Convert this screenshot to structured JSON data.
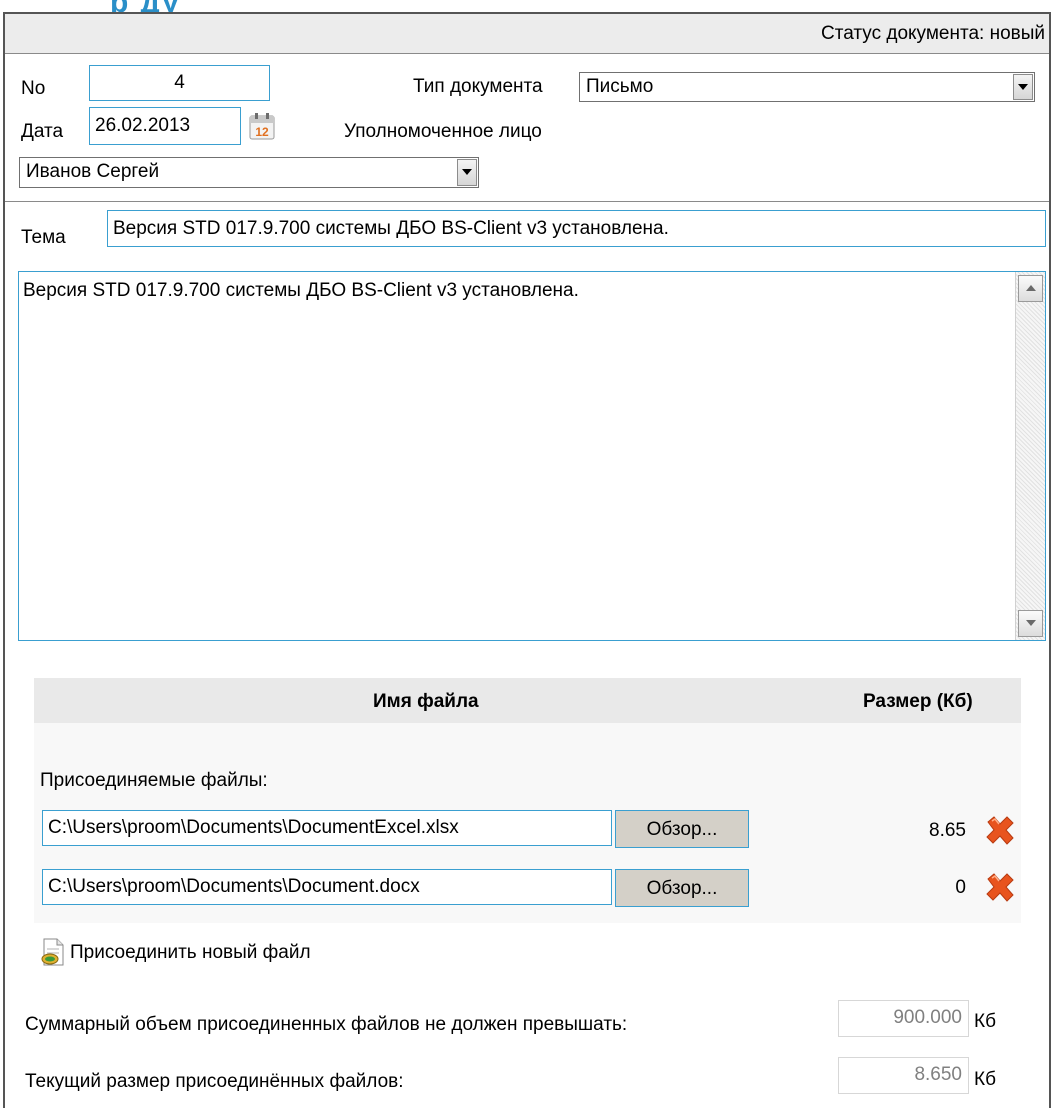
{
  "header": {
    "title_fragment": "р          ду",
    "status_label": "Статус документа: новый"
  },
  "form": {
    "number_label": "No",
    "number_value": "4",
    "doc_type_label": "Тип документа",
    "doc_type_value": "Письмо",
    "date_label": "Дата",
    "date_value": "26.02.2013",
    "calendar_day": "12",
    "authorized_label": "Уполномоченное лицо",
    "authorized_value": "Иванов Сергей",
    "subject_label": "Тема",
    "subject_value": "Версия STD 017.9.700 системы ДБО BS-Client v3 установлена.",
    "body_text": "Версия STD 017.9.700 системы ДБО BS-Client v3 установлена."
  },
  "files": {
    "col_name": "Имя файла",
    "col_size": "Размер (Кб)",
    "attached_label": "Присоединяемые файлы:",
    "rows": [
      {
        "path": "C:\\Users\\proom\\Documents\\DocumentExcel.xlsx",
        "browse": "Обзор...",
        "size": "8.65"
      },
      {
        "path": "C:\\Users\\proom\\Documents\\Document.docx",
        "browse": "Обзор...",
        "size": "0"
      }
    ],
    "attach_new_label": "Присоединить новый файл"
  },
  "limits": {
    "max_label": "Суммарный объем присоединенных файлов не должен превышать:",
    "max_value": "900.000",
    "max_unit": "Кб",
    "current_label": "Текущий размер присоединённых файлов:",
    "current_value": "8.650",
    "current_unit": "Кб"
  },
  "colors": {
    "accent_border": "#3a9fd0",
    "delete_icon": "#e8541e"
  }
}
